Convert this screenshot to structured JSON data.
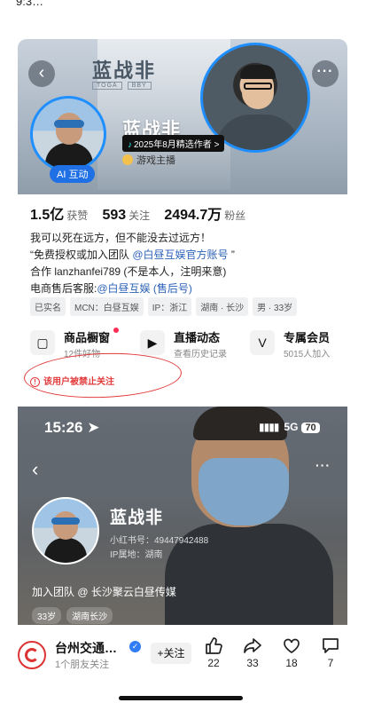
{
  "status_clip": "9:3…",
  "profile": {
    "banner_logo": "蓝战非",
    "banner_sub": [
      "TOGA",
      "BBY"
    ],
    "name": "蓝战非",
    "selected_badge": "2025年8月精选作者 >",
    "role": "游戏主播",
    "ai_badge": "AI 互动",
    "stats": [
      {
        "value": "1.5亿",
        "label": "获赞"
      },
      {
        "value": "593",
        "label": "关注"
      },
      {
        "value": "2494.7万",
        "label": "粉丝"
      }
    ],
    "bio": {
      "line1": "我可以死在远方，但不能没去过远方！",
      "line2_prefix": "“免费授权或加入团队 ",
      "line2_link": "@白昼互娱官方账号",
      "line2_suffix": " ”",
      "line3": "合作 lanzhanfei789 (不是本人，注明来意)",
      "line4_prefix": "电商售后客服:",
      "line4_link": "@白昼互娱 (售后号)"
    },
    "tags": [
      "已实名",
      "MCN：白昼互娱",
      "IP：浙江",
      "湖南 · 长沙",
      "男 · 33岁"
    ],
    "features": [
      {
        "title": "商品橱窗",
        "sub": "12件好物"
      },
      {
        "title": "直播动态",
        "sub": "查看历史记录"
      },
      {
        "title": "专属会员",
        "sub": "5015人加入"
      }
    ],
    "banned_notice": "该用户被禁止关注"
  },
  "phone": {
    "time": "15:26",
    "network": "5G",
    "battery": "70",
    "name": "蓝战非",
    "id_line": "小红书号：49447942488",
    "ip_line": "IP属地：湖南",
    "bio": "加入团队 @ 长沙聚云白昼传媒",
    "tags": [
      "33岁",
      "湖南长沙"
    ]
  },
  "footer": {
    "account_name": "台州交通…",
    "account_sub": "1个朋友关注",
    "follow_label": "+关注",
    "actions": [
      {
        "icon": "thumbs-up-icon",
        "count": "22"
      },
      {
        "icon": "share-icon",
        "count": "33"
      },
      {
        "icon": "heart-icon",
        "count": "18"
      },
      {
        "icon": "comment-icon",
        "count": "7"
      }
    ]
  },
  "colors": {
    "accent_blue": "#1f8fff",
    "link_blue": "#2b62b8",
    "warning_red": "#e23a3a"
  }
}
